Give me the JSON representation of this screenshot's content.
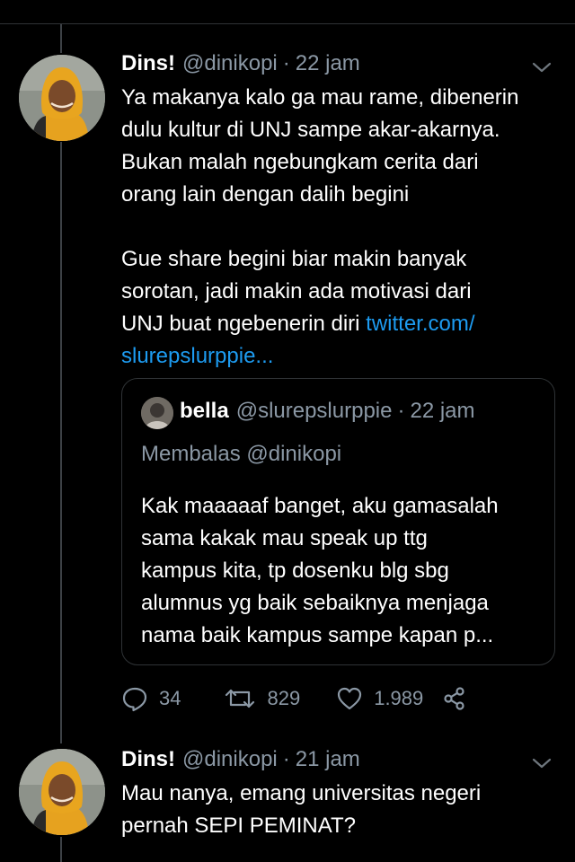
{
  "colors": {
    "background": "#000000",
    "text": "#ffffff",
    "muted": "#8b98a5",
    "link": "#1d9bf0",
    "border": "#2f3336"
  },
  "tweets": [
    {
      "name": "Dins!",
      "handle": "@dinikopi",
      "separator": "·",
      "time": "22 jam",
      "avatar_icon": "avatar-photo-hijab",
      "body": {
        "paragraph1": [
          "Ya makanya kalo ga mau rame, dibenerin",
          "dulu kultur di UNJ sampe akar-akarnya.",
          "Bukan malah ngebungkam cerita dari",
          "orang lain dengan dalih begini"
        ],
        "paragraph2": [
          "Gue share begini biar makin banyak",
          "sorotan, jadi makin ada motivasi dari"
        ],
        "line7_text": "UNJ buat ngebenerin diri ",
        "link_part1": "twitter.com/",
        "link_part2": "slurepslurppie..."
      },
      "quote": {
        "name": "bella",
        "handle": "@slurepslurppie",
        "separator": "·",
        "time": "22 jam",
        "reply_to": "Membalas @dinikopi",
        "text": [
          "Kak maaaaaf banget, aku gamasalah",
          "sama kakak mau speak up ttg",
          "kampus kita, tp dosenku blg sbg",
          "alumnus yg baik sebaiknya menjaga",
          "nama baik kampus sampe kapan p..."
        ]
      },
      "actions": {
        "replies": "34",
        "retweets": "829",
        "likes": "1.989",
        "icons": [
          "reply-icon",
          "retweet-icon",
          "like-icon",
          "share-icon"
        ]
      }
    },
    {
      "name": "Dins!",
      "handle": "@dinikopi",
      "separator": "·",
      "time": "21 jam",
      "avatar_icon": "avatar-photo-hijab",
      "body": [
        "Mau nanya, emang universitas negeri",
        "pernah SEPI PEMINAT?"
      ]
    }
  ]
}
